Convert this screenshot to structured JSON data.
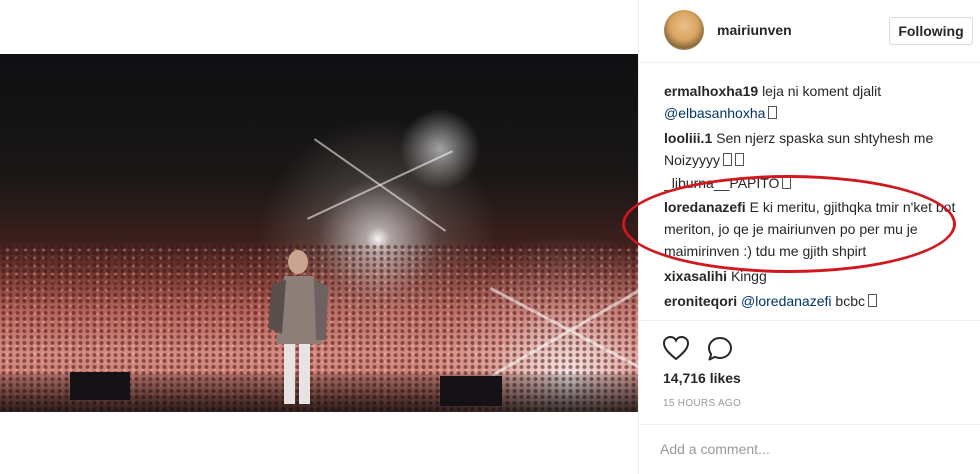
{
  "post": {
    "username": "mairiunven",
    "follow_label": "Following",
    "likes": "14,716 likes",
    "timestamp": "15 HOURS AGO",
    "add_comment_placeholder": "Add a comment..."
  },
  "comments": [
    {
      "user": "ermalhoxha19",
      "text": "leja ni koment djalit",
      "mention": "@elbasanhoxha",
      "tail": ""
    },
    {
      "user": "looliii.1",
      "text": "Sen njerz spaska sun shtyhesh me Noizyyyy",
      "mention": "",
      "tail": ""
    },
    {
      "user": "_liburna__",
      "text": "PAPITO",
      "mention": "",
      "tail": ""
    },
    {
      "user": "loredanazefi",
      "text": "E ki meritu, gjithqka tmir n'ket bot meriton, jo qe je mairiunven po per mu je maimirinven :) tdu me gjith shpirt",
      "mention": "",
      "tail": ""
    },
    {
      "user": "xixasalihi",
      "text": "Kingg",
      "mention": "",
      "tail": ""
    },
    {
      "user": "eroniteqori",
      "text": "",
      "mention": "@loredanazefi",
      "tail": "bcbc"
    }
  ],
  "icons": {
    "like": "heart-icon",
    "comment": "comment-bubble-icon"
  },
  "colors": {
    "highlight": "#d0181e",
    "mention": "#003569"
  }
}
